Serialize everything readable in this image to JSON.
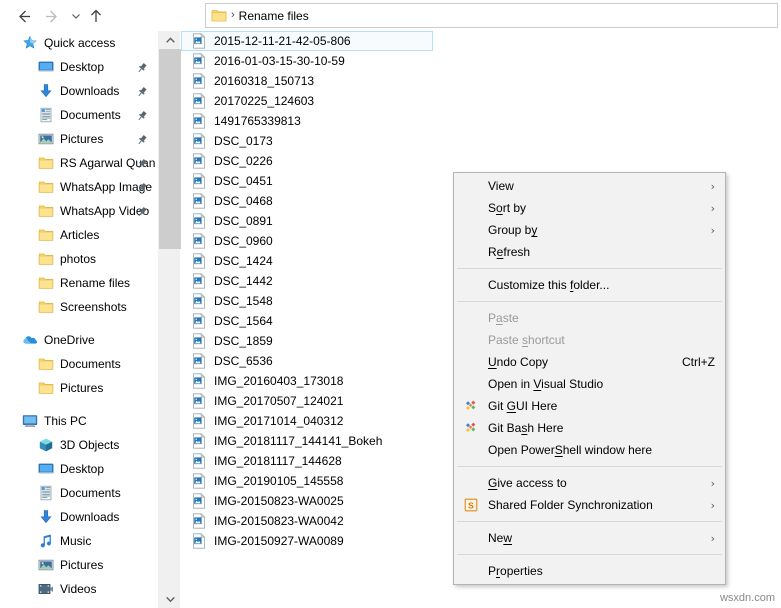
{
  "window": {
    "title": "Rename files"
  },
  "toolbar": {
    "back_label": "Back",
    "forward_label": "Forward",
    "recent_label": "Recent locations",
    "up_label": "Up one level",
    "back_icon": "arrow-left-icon",
    "forward_icon": "arrow-right-icon",
    "recent_icon": "chevron-down-icon",
    "up_icon": "arrow-up-icon"
  },
  "address_bar": {
    "folder_icon": "folder-icon",
    "separator": "›",
    "path_label": "Rename files"
  },
  "nav_pane": {
    "scrollbar": {
      "up_arrow": "˄",
      "down_arrow": "˅"
    },
    "groups": [
      {
        "header": {
          "label": "Quick access",
          "icon": "star-icon",
          "level": 0,
          "pinned": false
        },
        "items": [
          {
            "label": "Desktop",
            "icon": "desktop-icon",
            "level": 1,
            "pinned": true
          },
          {
            "label": "Downloads",
            "icon": "downloads-icon",
            "level": 1,
            "pinned": true
          },
          {
            "label": "Documents",
            "icon": "documents-icon",
            "level": 1,
            "pinned": true
          },
          {
            "label": "Pictures",
            "icon": "pictures-icon",
            "level": 1,
            "pinned": true
          },
          {
            "label": "RS Agarwal Quan",
            "icon": "folder-icon",
            "level": 1,
            "pinned": true
          },
          {
            "label": "WhatsApp Image",
            "icon": "folder-icon",
            "level": 1,
            "pinned": true
          },
          {
            "label": "WhatsApp Video",
            "icon": "folder-icon",
            "level": 1,
            "pinned": true
          },
          {
            "label": "Articles",
            "icon": "folder-icon",
            "level": 1,
            "pinned": false
          },
          {
            "label": "photos",
            "icon": "folder-icon",
            "level": 1,
            "pinned": false
          },
          {
            "label": "Rename files",
            "icon": "folder-icon",
            "level": 1,
            "pinned": false
          },
          {
            "label": "Screenshots",
            "icon": "folder-icon",
            "level": 1,
            "pinned": false
          }
        ]
      },
      {
        "header": {
          "label": "OneDrive",
          "icon": "onedrive-cloud-icon",
          "level": 0,
          "pinned": false
        },
        "items": [
          {
            "label": "Documents",
            "icon": "folder-icon",
            "level": 1,
            "pinned": false
          },
          {
            "label": "Pictures",
            "icon": "folder-icon",
            "level": 1,
            "pinned": false
          }
        ]
      },
      {
        "header": {
          "label": "This PC",
          "icon": "this-pc-icon",
          "level": 0,
          "pinned": false
        },
        "items": [
          {
            "label": "3D Objects",
            "icon": "3d-objects-icon",
            "level": 1,
            "pinned": false
          },
          {
            "label": "Desktop",
            "icon": "desktop-icon",
            "level": 1,
            "pinned": false
          },
          {
            "label": "Documents",
            "icon": "documents-icon",
            "level": 1,
            "pinned": false
          },
          {
            "label": "Downloads",
            "icon": "downloads-icon",
            "level": 1,
            "pinned": false
          },
          {
            "label": "Music",
            "icon": "music-icon",
            "level": 1,
            "pinned": false
          },
          {
            "label": "Pictures",
            "icon": "pictures-icon",
            "level": 1,
            "pinned": false
          },
          {
            "label": "Videos",
            "icon": "videos-icon",
            "level": 1,
            "pinned": false
          }
        ]
      }
    ]
  },
  "file_list": {
    "item_icon": "image-file-icon",
    "items": [
      {
        "name": "2015-12-11-21-42-05-806",
        "selected": true
      },
      {
        "name": "2016-01-03-15-30-10-59",
        "selected": false
      },
      {
        "name": "20160318_150713",
        "selected": false
      },
      {
        "name": "20170225_124603",
        "selected": false
      },
      {
        "name": "1491765339813",
        "selected": false
      },
      {
        "name": "DSC_0173",
        "selected": false
      },
      {
        "name": "DSC_0226",
        "selected": false
      },
      {
        "name": "DSC_0451",
        "selected": false
      },
      {
        "name": "DSC_0468",
        "selected": false
      },
      {
        "name": "DSC_0891",
        "selected": false
      },
      {
        "name": "DSC_0960",
        "selected": false
      },
      {
        "name": "DSC_1424",
        "selected": false
      },
      {
        "name": "DSC_1442",
        "selected": false
      },
      {
        "name": "DSC_1548",
        "selected": false
      },
      {
        "name": "DSC_1564",
        "selected": false
      },
      {
        "name": "DSC_1859",
        "selected": false
      },
      {
        "name": "DSC_6536",
        "selected": false
      },
      {
        "name": "IMG_20160403_173018",
        "selected": false
      },
      {
        "name": "IMG_20170507_124021",
        "selected": false
      },
      {
        "name": "IMG_20171014_040312",
        "selected": false
      },
      {
        "name": "IMG_20181117_144141_Bokeh",
        "selected": false
      },
      {
        "name": "IMG_20181117_144628",
        "selected": false
      },
      {
        "name": "IMG_20190105_145558",
        "selected": false
      },
      {
        "name": "IMG-20150823-WA0025",
        "selected": false
      },
      {
        "name": "IMG-20150823-WA0042",
        "selected": false
      },
      {
        "name": "IMG-20150927-WA0089",
        "selected": false
      }
    ]
  },
  "context_menu": {
    "submenu_arrow": "›",
    "items": [
      {
        "type": "item",
        "pre": "V",
        "accel": "",
        "post": "iew",
        "label": "View",
        "submenu": true,
        "disabled": false,
        "icon": ""
      },
      {
        "type": "item",
        "pre": "S",
        "accel": "o",
        "post": "rt by",
        "label": "Sort by",
        "submenu": true,
        "disabled": false,
        "icon": ""
      },
      {
        "type": "item",
        "pre": "Group b",
        "accel": "y",
        "post": "",
        "label": "Group by",
        "submenu": true,
        "disabled": false,
        "icon": ""
      },
      {
        "type": "item",
        "pre": "R",
        "accel": "e",
        "post": "fresh",
        "label": "Refresh",
        "submenu": false,
        "disabled": false,
        "icon": ""
      },
      {
        "type": "separator"
      },
      {
        "type": "item",
        "pre": "Customize this ",
        "accel": "f",
        "post": "older...",
        "label": "Customize this folder...",
        "submenu": false,
        "disabled": false,
        "icon": ""
      },
      {
        "type": "separator"
      },
      {
        "type": "item",
        "pre": "P",
        "accel": "a",
        "post": "ste",
        "label": "Paste",
        "submenu": false,
        "disabled": true,
        "icon": ""
      },
      {
        "type": "item",
        "pre": "Paste ",
        "accel": "s",
        "post": "hortcut",
        "label": "Paste shortcut",
        "submenu": false,
        "disabled": true,
        "icon": ""
      },
      {
        "type": "item",
        "pre": "",
        "accel": "U",
        "post": "ndo Copy",
        "label": "Undo Copy",
        "shortcut": "Ctrl+Z",
        "submenu": false,
        "disabled": false,
        "icon": ""
      },
      {
        "type": "item",
        "pre": "Open in ",
        "accel": "V",
        "post": "isual Studio",
        "label": "Open in Visual Studio",
        "submenu": false,
        "disabled": false,
        "icon": ""
      },
      {
        "type": "item",
        "pre": "Git ",
        "accel": "G",
        "post": "UI Here",
        "label": "Git GUI Here",
        "submenu": false,
        "disabled": false,
        "icon": "git-icon"
      },
      {
        "type": "item",
        "pre": "Git Ba",
        "accel": "s",
        "post": "h Here",
        "label": "Git Bash Here",
        "submenu": false,
        "disabled": false,
        "icon": "git-icon"
      },
      {
        "type": "item",
        "pre": "Open Power",
        "accel": "S",
        "post": "hell window here",
        "label": "Open PowerShell window here",
        "submenu": false,
        "disabled": false,
        "icon": ""
      },
      {
        "type": "separator"
      },
      {
        "type": "item",
        "pre": "",
        "accel": "G",
        "post": "ive access to",
        "label": "Give access to",
        "submenu": true,
        "disabled": false,
        "icon": ""
      },
      {
        "type": "item",
        "pre": "Shared Folder Synchronization",
        "accel": "",
        "post": "",
        "label": "Shared Folder Synchronization",
        "submenu": true,
        "disabled": false,
        "icon": "shared-folder-sync-icon"
      },
      {
        "type": "separator"
      },
      {
        "type": "item",
        "pre": "Ne",
        "accel": "w",
        "post": "",
        "label": "New",
        "submenu": true,
        "disabled": false,
        "icon": ""
      },
      {
        "type": "separator"
      },
      {
        "type": "item",
        "pre": "P",
        "accel": "r",
        "post": "operties",
        "label": "Properties",
        "submenu": false,
        "disabled": false,
        "icon": ""
      }
    ]
  },
  "watermark": {
    "text": "wsxdn.com"
  }
}
